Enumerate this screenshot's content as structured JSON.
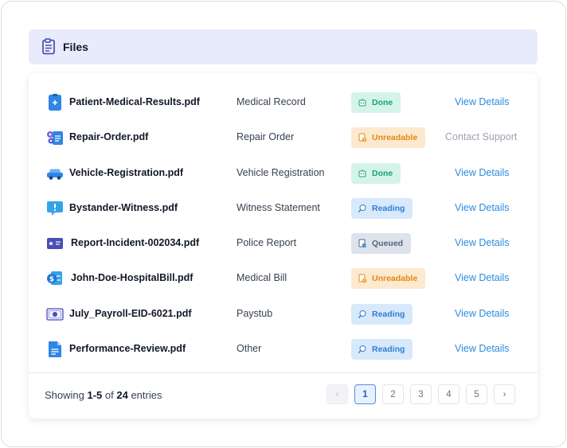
{
  "header": {
    "title": "Files",
    "icon": "clipboard-document-icon"
  },
  "files": [
    {
      "name": "Patient-Medical-Results.pdf",
      "type": "Medical Record",
      "status": "Done",
      "status_kind": "done",
      "action": "View Details",
      "action_kind": "link",
      "icon": "medical-clipboard-icon"
    },
    {
      "name": "Repair-Order.pdf",
      "type": "Repair Order",
      "status": "Unreadable",
      "status_kind": "unreadable",
      "action": "Contact Support",
      "action_kind": "muted",
      "icon": "gears-clipboard-icon"
    },
    {
      "name": "Vehicle-Registration.pdf",
      "type": "Vehicle Registration",
      "status": "Done",
      "status_kind": "done",
      "action": "View Details",
      "action_kind": "link",
      "icon": "car-icon"
    },
    {
      "name": "Bystander-Witness.pdf",
      "type": "Witness Statement",
      "status": "Reading",
      "status_kind": "reading",
      "action": "View Details",
      "action_kind": "link",
      "icon": "speech-bubble-alert-icon"
    },
    {
      "name": "Report-Incident-002034.pdf",
      "type": "Police Report",
      "status": "Queued",
      "status_kind": "queued",
      "action": "View Details",
      "action_kind": "link",
      "icon": "police-badge-card-icon"
    },
    {
      "name": "John-Doe-HospitalBill.pdf",
      "type": "Medical Bill",
      "status": "Unreadable",
      "status_kind": "unreadable",
      "action": "View Details",
      "action_kind": "link",
      "icon": "dollar-bill-icon"
    },
    {
      "name": "July_Payroll-EID-6021.pdf",
      "type": "Paystub",
      "status": "Reading",
      "status_kind": "reading",
      "action": "View Details",
      "action_kind": "link",
      "icon": "banknote-icon"
    },
    {
      "name": "Performance-Review.pdf",
      "type": "Other",
      "status": "Reading",
      "status_kind": "reading",
      "action": "View Details",
      "action_kind": "link",
      "icon": "document-icon"
    }
  ],
  "footer": {
    "showing_prefix": "Showing ",
    "range": "1-5",
    "of": " of ",
    "total": "24",
    "suffix": " entries"
  },
  "pagination": {
    "prev_glyph": "‹",
    "next_glyph": "›",
    "pages": [
      "1",
      "2",
      "3",
      "4",
      "5"
    ],
    "current": "1"
  },
  "colors": {
    "accent": "#2d8ce0",
    "header_bg": "#e8ebfc",
    "done": "#16a37a",
    "unreadable": "#e08a14",
    "reading": "#2f7fd2",
    "queued": "#55657a"
  }
}
